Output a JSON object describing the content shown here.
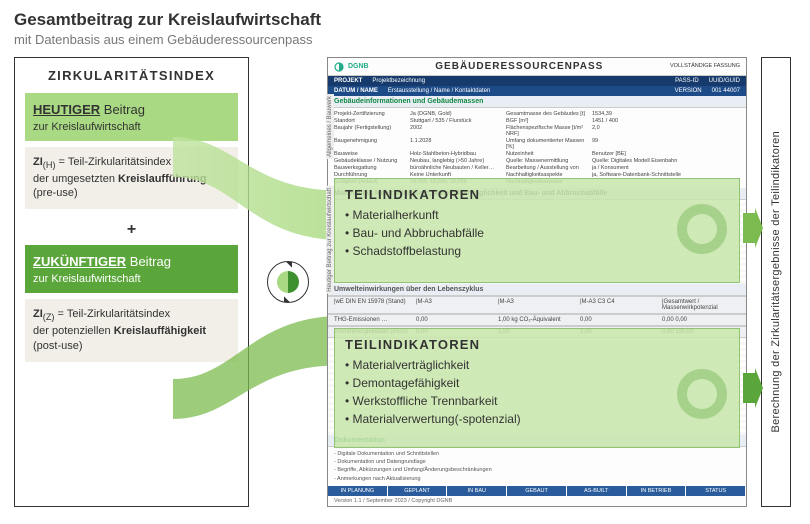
{
  "title": "Gesamtbeitrag zur Kreislaufwirtschaft",
  "subtitle": "mit Datenbasis aus einem Gebäuderessourcenpass",
  "left": {
    "heading": "ZIRKULARITÄTSINDEX",
    "today_label_bold": "HEUTIGER",
    "today_label_reg": " Beitrag",
    "today_sub": "zur Kreislaufwirtschaft",
    "zi_h_prefix": "ZI",
    "zi_h_sub": "(H)",
    "zi_h_eq": " = Teil-Zirkularitätsindex",
    "zi_h_line2a": "der umgesetzten ",
    "zi_h_line2b": "Kreislaufführung",
    "zi_h_line3": "(pre-use)",
    "plus": "+",
    "future_label_bold": "ZUKÜNFTIGER",
    "future_label_reg": " Beitrag",
    "future_sub": "zur Kreislaufwirtschaft",
    "zi_z_prefix": "ZI",
    "zi_z_sub": "(Z)",
    "zi_z_eq": " = Teil-Zirkularitätsindex",
    "zi_z_line2a": "der potenziellen ",
    "zi_z_line2b": "Kreislauffähigkeit",
    "zi_z_line3": "(post-use)"
  },
  "doc": {
    "logo_text": "DGNB",
    "title": "GEBÄUDERESSOURCENPASS",
    "version_tag": "VOLLSTÄNDIGE FASSUNG",
    "bar1_l": "PROJEKT",
    "bar1_r": "Projektbezeichnung",
    "bar1_c1": "PASS-ID",
    "bar1_c2": "UUID/GUID",
    "bar2_l": "DATUM / NAME",
    "bar2_r": "Erstausstellung / Name / Kontaktdaten",
    "bar2_c1": "VERSION",
    "bar2_c2": "001  44007",
    "sec1": "Gebäudeinformationen und Gebäudemassen",
    "info_labels": [
      "Projekt-Zertifizierung",
      "Ja (DGNB, Gold)",
      "Gesamtmasse des Gebäudes [t]",
      "1534,39",
      "Standort",
      "Stuttgart / 535 / Flurstück",
      "BGF [m²]",
      "1451 / 400",
      "Baujahr (Fertigstellung)",
      "2002",
      "Flächenspezifische Masse [t/m² NRF]",
      "2,0",
      "Baugenehmigung",
      "1.1.2028",
      "Umfang dokumentierter Massen [%]",
      "99",
      "Bauweise",
      "Holz-Stahlbeton-Hybridbau",
      "Nutzeinheit",
      "Benutzer [BE]",
      "Gebäudeklasse / Nutzung",
      "Neubau, langlebig (>50 Jahre)",
      "Quelle: Massenermittlung",
      "Quelle: Digitales Modell Eisenbahn",
      "Bauwerksgattung",
      "büroähnliche Neubauten / Keller…",
      "Bearbeitung / Ausstellung von",
      "ja / Konsument",
      "Durchführung",
      "Keine Unterkunft",
      "Nachhaltigkeitsaspekte",
      "ja, Software-Datenbank-Schnittstelle",
      "Gültigkeit (Ablauf)",
      "18.009, 18.099, 18.099",
      "Nachhaltigkeitsaspekte",
      ""
    ],
    "sec2": "Materialität, Materialherkunft, Materialverträglichkeit und Bau- und Abbruchabfälle",
    "sec3": "Umwelteinwirkungen über den Lebenszyklus",
    "mid_row": [
      "|wE DIN EN 15978 (Stand)",
      "|M-A3",
      "|M-A3",
      "|M-A3  C3 C4",
      "|Gesamtwert / Massenwirkpotenzial"
    ],
    "mid_row2": [
      "THG-Emissionen …",
      "0,00",
      "1,00 kg CO₂-Äquivalent",
      "0,00",
      "0,00  0,00"
    ],
    "mid_row3": [
      "Primärenergiebedarf (PEnr)",
      "0,00",
      "1,00",
      "1,00",
      "0,00  130,00"
    ],
    "sec4": "Dokumentation",
    "doc_items": [
      "Digitale Dokumentation und Schnittstellen",
      "Dokumentation und Datengrundlage",
      "Begriffe, Abkürzungen und Umfang/Änderungsbeschränkungen",
      "Anmerkungen nach Aktualisierung"
    ],
    "status": [
      "IN PLANUNG",
      "GEPLANT",
      "IN BAU",
      "GEBAUT",
      "AS-BUILT",
      "IN BETRIEB",
      "STATUS"
    ],
    "version_line": "Version 1.1 / September 2023 / Copyright DGNB",
    "side_a": "Allgemeines / Bauwerk",
    "side_b": "Heutiger Beitrag zur Kreislaufwirtschaft"
  },
  "ov1": {
    "title": "TEILINDIKATOREN",
    "items": [
      "Materialherkunft",
      "Bau- und Abbruchabfälle",
      "Schadstoffbelastung"
    ]
  },
  "ov2": {
    "title": "TEILINDIKATOREN",
    "items": [
      "Materialverträglichkeit",
      "Demontagefähigkeit",
      "Werkstoffliche Trennbarkeit",
      "Materialverwertung(-spotenzial)"
    ]
  },
  "right_label": "Berechnung der Zirkularitätsergebnisse der Teilindikatoren"
}
